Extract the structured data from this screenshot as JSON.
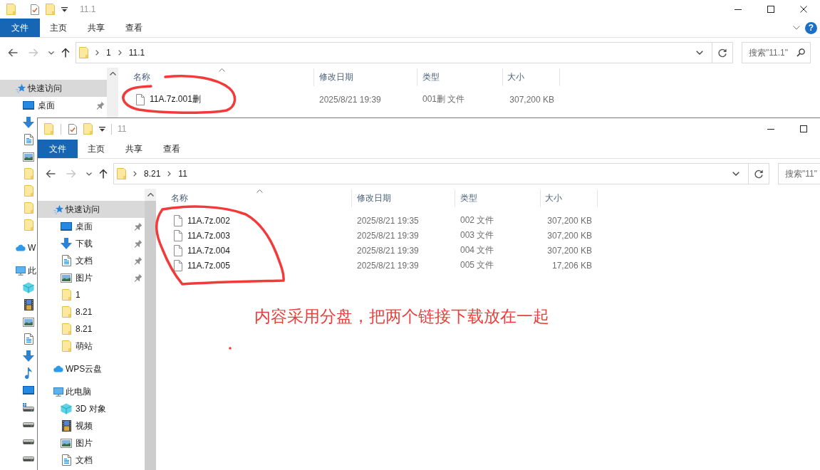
{
  "windows": [
    {
      "active": false,
      "quick_access": [
        {
          "kind": "folder"
        },
        {
          "kind": "properties"
        },
        {
          "kind": "folder"
        },
        {
          "kind": "customize"
        }
      ],
      "title": "11.1",
      "controls": [
        {
          "kind": "minimize"
        },
        {
          "kind": "maximize"
        },
        {
          "kind": "close"
        }
      ],
      "ribbon": [
        {
          "label": "文件",
          "kind": "file",
          "selected": false
        },
        {
          "label": "主页",
          "kind": "tab",
          "selected": false
        },
        {
          "label": "共享",
          "kind": "tab",
          "selected": false
        },
        {
          "label": "查看",
          "kind": "tab",
          "selected": false
        }
      ],
      "ribbon_buttons": [
        {
          "kind": "collapse"
        },
        {
          "kind": "help",
          "label": "?"
        }
      ],
      "nav_buttons": [
        {
          "kind": "back",
          "disabled": false
        },
        {
          "kind": "forward",
          "disabled": true
        },
        {
          "kind": "recent",
          "disabled": false
        },
        {
          "kind": "up",
          "disabled": false
        }
      ],
      "path": [
        "1",
        "11.1"
      ],
      "search": {
        "placeholder": "搜索\"11.1\"",
        "search_button": true
      },
      "nav": [
        {
          "kind": "star",
          "label": "快速访问",
          "selected": true,
          "children": [
            {
              "kind": "desktop",
              "label": "桌面",
              "pinned": true,
              "selected": false
            },
            {
              "kind": "download",
              "pinned": false,
              "selected": false
            },
            {
              "kind": "document",
              "pinned": false,
              "selected": false
            },
            {
              "kind": "picture",
              "pinned": false,
              "selected": false
            },
            {
              "kind": "folder",
              "pinned": false,
              "selected": false
            },
            {
              "kind": "folder",
              "pinned": false,
              "selected": false
            },
            {
              "kind": "folder",
              "pinned": false,
              "selected": false
            },
            {
              "kind": "folder",
              "pinned": false,
              "selected": false
            }
          ]
        },
        {
          "kind": "cloud",
          "label": "W",
          "selected": false
        },
        {
          "kind": "computer",
          "label": "此",
          "selected": false,
          "children": [
            {
              "kind": "cube",
              "selected": false
            },
            {
              "kind": "video",
              "selected": false
            },
            {
              "kind": "picture",
              "selected": false
            },
            {
              "kind": "document",
              "selected": false
            },
            {
              "kind": "download",
              "selected": false
            },
            {
              "kind": "music",
              "selected": false
            },
            {
              "kind": "desktop",
              "selected": false
            },
            {
              "kind": "system-drive",
              "selected": false
            },
            {
              "kind": "drive",
              "selected": false
            },
            {
              "kind": "drive",
              "selected": false
            },
            {
              "kind": "drive",
              "selected": false
            }
          ]
        }
      ],
      "columns": [
        {
          "label": "名称",
          "sorted": true
        },
        {
          "label": "修改日期",
          "sorted": false
        },
        {
          "label": "类型",
          "sorted": false
        },
        {
          "label": "大小",
          "sorted": false
        }
      ],
      "files": [
        {
          "name": "11A.7z.001删",
          "modified": "2025/8/21 19:39",
          "type": "001删 文件",
          "size": "307,200 KB",
          "selected": false
        }
      ]
    },
    {
      "active": true,
      "quick_access": [
        {
          "kind": "folder"
        },
        {
          "kind": "properties"
        },
        {
          "kind": "folder"
        },
        {
          "kind": "customize"
        }
      ],
      "title": "11",
      "controls": [
        {
          "kind": "minimize"
        },
        {
          "kind": "maximize"
        }
      ],
      "ribbon": [
        {
          "label": "文件",
          "kind": "file",
          "selected": false
        },
        {
          "label": "主页",
          "kind": "tab",
          "selected": false
        },
        {
          "label": "共享",
          "kind": "tab",
          "selected": false
        },
        {
          "label": "查看",
          "kind": "tab",
          "selected": false
        }
      ],
      "nav_buttons": [
        {
          "kind": "back",
          "disabled": false
        },
        {
          "kind": "forward",
          "disabled": true
        },
        {
          "kind": "recent",
          "disabled": false
        },
        {
          "kind": "up",
          "disabled": false
        }
      ],
      "path": [
        "8.21",
        "11"
      ],
      "search": {
        "placeholder": "搜索\"11\"",
        "search_button": false
      },
      "nav": [
        {
          "kind": "star",
          "label": "快速访问",
          "selected": true,
          "children": [
            {
              "kind": "desktop",
              "label": "桌面",
              "pinned": true,
              "selected": false
            },
            {
              "kind": "download",
              "label": "下载",
              "pinned": true,
              "selected": false
            },
            {
              "kind": "document",
              "label": "文档",
              "pinned": true,
              "selected": false
            },
            {
              "kind": "picture",
              "label": "图片",
              "pinned": true,
              "selected": false
            },
            {
              "kind": "folder",
              "label": "1",
              "pinned": false,
              "selected": false
            },
            {
              "kind": "folder",
              "label": "8.21",
              "pinned": false,
              "selected": false
            },
            {
              "kind": "folder",
              "label": "8.21",
              "pinned": false,
              "selected": false
            },
            {
              "kind": "folder",
              "label": "萌站",
              "pinned": false,
              "selected": false
            }
          ]
        },
        {
          "kind": "cloud",
          "label": "WPS云盘",
          "selected": false
        },
        {
          "kind": "computer",
          "label": "此电脑",
          "selected": false,
          "children": [
            {
              "kind": "cube",
              "label": "3D 对象",
              "selected": false
            },
            {
              "kind": "video",
              "label": "视频",
              "selected": false
            },
            {
              "kind": "picture",
              "label": "图片",
              "selected": false
            },
            {
              "kind": "document",
              "label": "文档",
              "selected": false
            }
          ]
        }
      ],
      "columns": [
        {
          "label": "名称",
          "sorted": true
        },
        {
          "label": "修改日期",
          "sorted": false
        },
        {
          "label": "类型",
          "sorted": false
        },
        {
          "label": "大小",
          "sorted": false
        }
      ],
      "files": [
        {
          "name": "11A.7z.002",
          "modified": "2025/8/21 19:35",
          "type": "002 文件",
          "size": "307,200 KB",
          "selected": false
        },
        {
          "name": "11A.7z.003",
          "modified": "2025/8/21 19:39",
          "type": "003 文件",
          "size": "307,200 KB",
          "selected": false
        },
        {
          "name": "11A.7z.004",
          "modified": "2025/8/21 19:39",
          "type": "004 文件",
          "size": "307,200 KB",
          "selected": false
        },
        {
          "name": "11A.7z.005",
          "modified": "2025/8/21 19:39",
          "type": "005 文件",
          "size": "17,206 KB",
          "selected": false
        }
      ]
    }
  ],
  "note": "内容采用分盘，把两个链接下载放在一起"
}
